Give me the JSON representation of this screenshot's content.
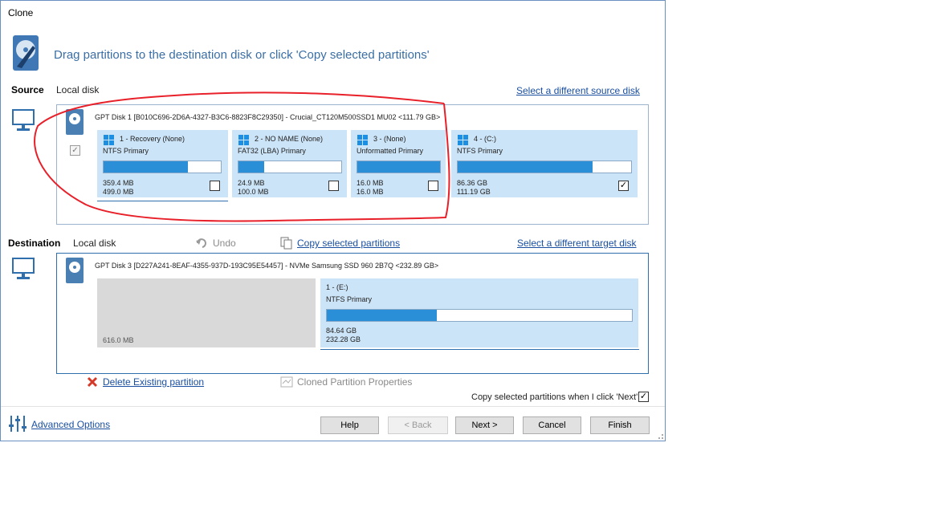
{
  "window": {
    "title": "Clone"
  },
  "header": {
    "instruction": "Drag partitions to the destination disk or click 'Copy selected partitions'",
    "icon": "clone-wizard-icon"
  },
  "source": {
    "label": "Source",
    "sublabel": "Local disk",
    "change_link": "Select a different source disk",
    "disk_title": "GPT Disk 1 [B010C696-2D6A-4327-B3C6-8823F8C29350] - Crucial_CT120M500SSD1 MU02  <111.79 GB>",
    "partitions": [
      {
        "title": "1 - Recovery (None)",
        "fs": "NTFS Primary",
        "used": "359.4 MB",
        "total": "499.0 MB",
        "fill": 0.72,
        "checked": false
      },
      {
        "title": "2 - NO NAME (None)",
        "fs": "FAT32 (LBA) Primary",
        "used": "24.9 MB",
        "total": "100.0 MB",
        "fill": 0.25,
        "checked": false
      },
      {
        "title": "3 -  (None)",
        "fs": "Unformatted Primary",
        "used": "16.0 MB",
        "total": "16.0 MB",
        "fill": 1.0,
        "checked": false
      },
      {
        "title": "4 -  (C:)",
        "fs": "NTFS Primary",
        "used": "86.36 GB",
        "total": "111.19 GB",
        "fill": 0.78,
        "checked": true
      }
    ]
  },
  "destination": {
    "label": "Destination",
    "sublabel": "Local disk",
    "undo": "Undo",
    "copy_link": "Copy selected partitions",
    "change_link": "Select a different target disk",
    "disk_title": "GPT Disk 3 [D227A241-8EAF-4355-937D-193C95E54457] - NVMe    Samsung SSD 960  2B7Q  <232.89 GB>",
    "unallocated": "616.0 MB",
    "partition": {
      "title": "1 -  (E:)",
      "fs": "NTFS Primary",
      "used": "84.64 GB",
      "total": "232.28 GB",
      "fill": 0.36
    }
  },
  "actions": {
    "delete": "Delete Existing partition",
    "properties": "Cloned Partition Properties",
    "copy_on_next": "Copy selected partitions when I click 'Next'",
    "copy_on_next_checked": true
  },
  "footer": {
    "advanced": "Advanced Options",
    "help": "Help",
    "back": "< Back",
    "next": "Next >",
    "cancel": "Cancel",
    "finish": "Finish"
  },
  "colors": {
    "partition_bg": "#cce4f7",
    "bar_fill": "#2a8fd6",
    "link": "#1a4fa0",
    "annotation": "#e8202a"
  }
}
